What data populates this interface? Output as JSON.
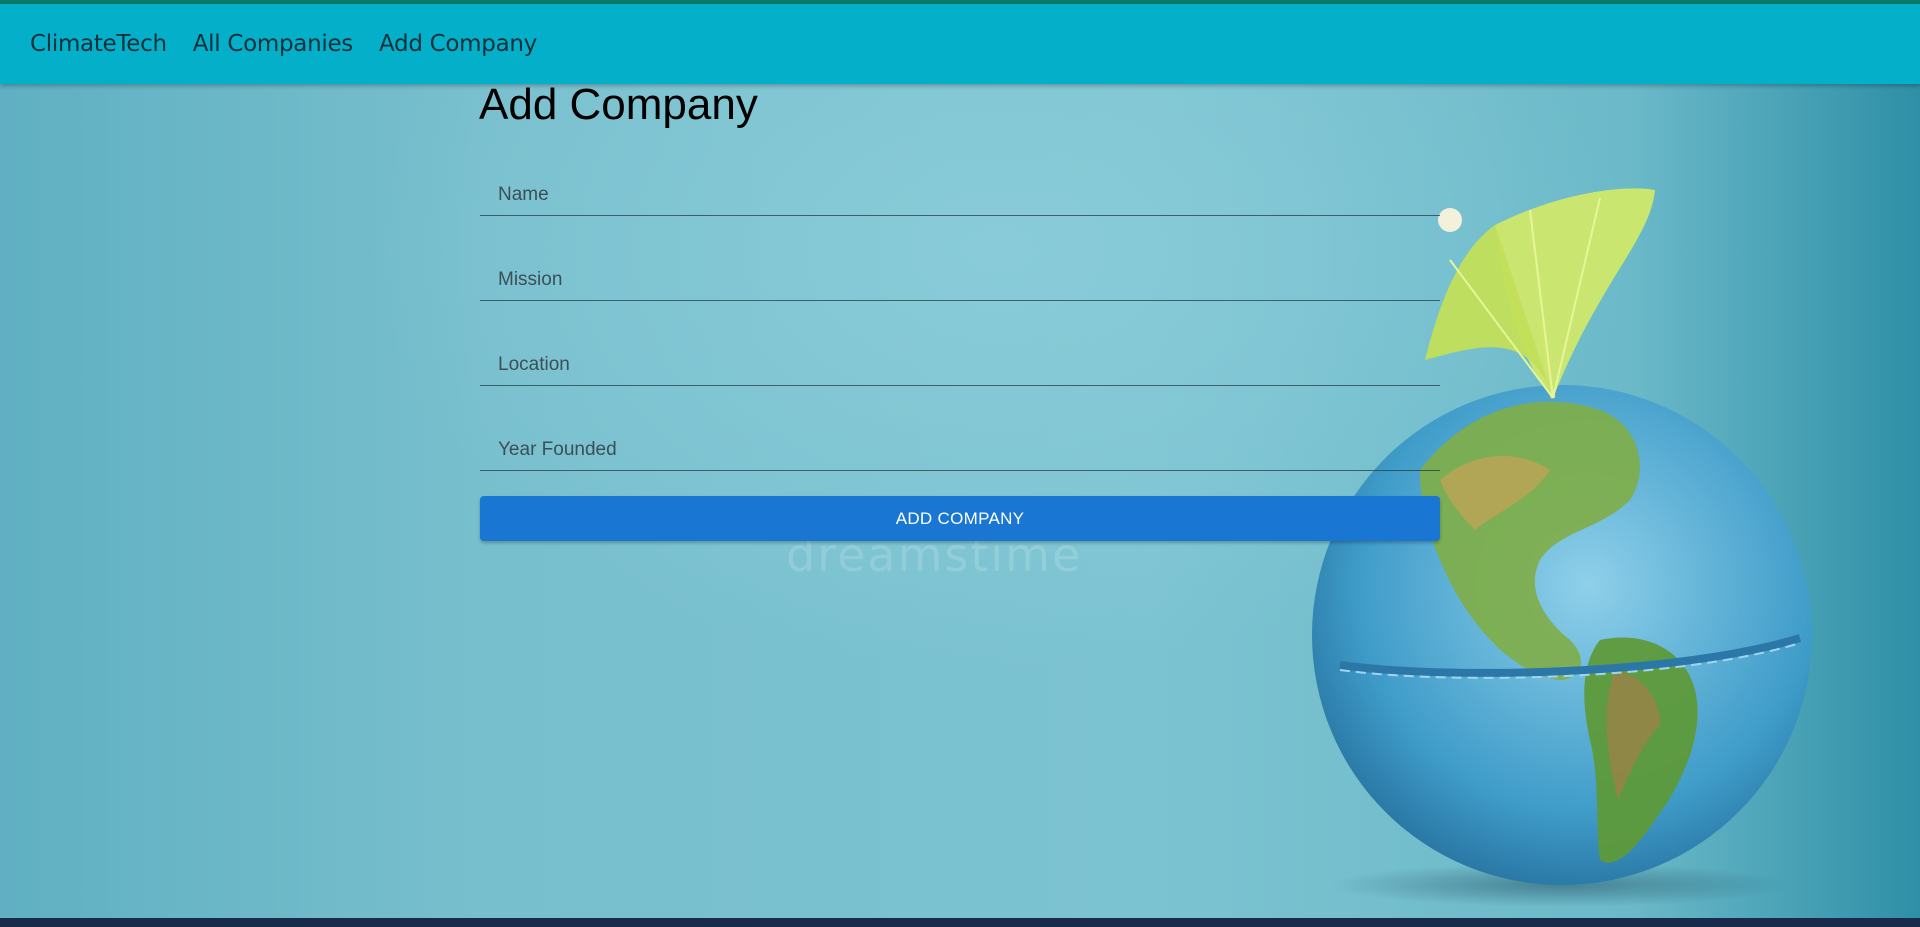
{
  "nav": {
    "brand": "ClimateTech",
    "links": [
      "All Companies",
      "Add Company"
    ]
  },
  "page": {
    "title": "Add Company"
  },
  "form": {
    "fields": [
      {
        "placeholder": "Name",
        "value": ""
      },
      {
        "placeholder": "Mission",
        "value": ""
      },
      {
        "placeholder": "Location",
        "value": ""
      },
      {
        "placeholder": "Year Founded",
        "value": ""
      }
    ],
    "submit_label": "ADD COMPANY"
  },
  "background": {
    "watermark_text": "dreamstime",
    "image_icon": "globe-with-umbrella-illustration"
  },
  "colors": {
    "navbar": "#04afca",
    "button": "#1976d2",
    "background": "#7fc3d0"
  }
}
